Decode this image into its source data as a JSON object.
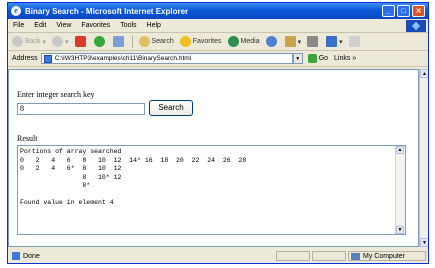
{
  "window": {
    "title": "Binary Search - Microsoft Internet Explorer"
  },
  "menu": [
    "File",
    "Edit",
    "View",
    "Favorites",
    "Tools",
    "Help"
  ],
  "toolbar": {
    "back": "Back",
    "search": "Search",
    "favorites": "Favorites",
    "media": "Media"
  },
  "address": {
    "label": "Address",
    "url": "C:\\IW3HTP3\\examples\\ch11\\BinarySearch.html",
    "go": "Go",
    "links": "Links"
  },
  "form": {
    "prompt": "Enter integer search key",
    "search_value": "8",
    "search_button": "Search",
    "result_label": "Result",
    "result_text": "Portions of array searched\n0   2   4   6   8   10  12  14* 16  18  20  22  24  26  28\n0   2   4   6*  8   10  12\n                8   10* 12\n                8*\n\nFound value in element 4"
  },
  "status": {
    "text": "Done",
    "zone": "My Computer"
  }
}
